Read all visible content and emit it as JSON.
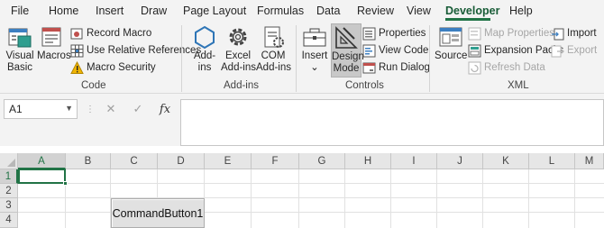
{
  "menu": {
    "tabs": [
      "File",
      "Home",
      "Insert",
      "Draw",
      "Page Layout",
      "Formulas",
      "Data",
      "Review",
      "View",
      "Developer",
      "Help"
    ],
    "active": "Developer"
  },
  "ribbon": {
    "code": {
      "label": "Code",
      "visual_basic": [
        "Visual",
        "Basic"
      ],
      "macros": "Macros",
      "record_macro": "Record Macro",
      "use_relative": "Use Relative References",
      "macro_security": "Macro Security"
    },
    "addins": {
      "label": "Add-ins",
      "addins_btn": [
        "Add-",
        "ins"
      ],
      "excel_addins": [
        "Excel",
        "Add-ins"
      ],
      "com_addins": [
        "COM",
        "Add-ins"
      ]
    },
    "controls": {
      "label": "Controls",
      "insert": "Insert",
      "insert_arrow": "⌄",
      "design_mode": [
        "Design",
        "Mode"
      ],
      "properties": "Properties",
      "view_code": "View Code",
      "run_dialog": "Run Dialog"
    },
    "xml": {
      "label": "XML",
      "source": "Source",
      "map_properties": "Map Properties",
      "expansion_packs": "Expansion Packs",
      "refresh_data": "Refresh Data",
      "import": "Import",
      "export": "Export"
    }
  },
  "formula_bar": {
    "name_box": "A1",
    "cancel_symbol": "✕",
    "enter_symbol": "✓",
    "fx_symbol": "fx",
    "formula": ""
  },
  "sheet": {
    "columns": [
      "A",
      "B",
      "C",
      "D",
      "E",
      "F",
      "G",
      "H",
      "I",
      "J",
      "K",
      "L",
      "M"
    ],
    "rows": [
      "1",
      "2",
      "3",
      "4"
    ],
    "selected_cell": "A1",
    "command_button": "CommandButton1"
  },
  "colors": {
    "accent": "#217346",
    "ribbon_bg": "#f3f3f3"
  }
}
